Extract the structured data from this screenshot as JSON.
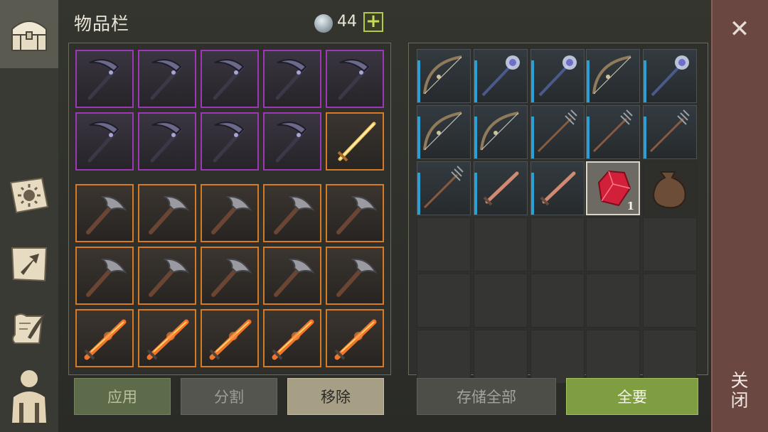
{
  "header": {
    "title": "物品栏",
    "currency_amount": "44",
    "add_label": "+"
  },
  "left_rail": {
    "items": [
      "chest-icon",
      "map-sun-icon",
      "map-arrow-icon",
      "scroll-quill-icon",
      "character-icon"
    ]
  },
  "inventory": {
    "rows_top": [
      [
        "purple-scythe",
        "purple-scythe",
        "purple-scythe",
        "purple-scythe",
        "purple-scythe"
      ],
      [
        "purple-scythe",
        "purple-scythe",
        "purple-scythe",
        "purple-scythe",
        "golden-sword"
      ]
    ],
    "rows_bottom": [
      [
        "iron-pickaxe",
        "iron-pickaxe",
        "iron-pickaxe",
        "iron-pickaxe",
        "iron-pickaxe"
      ],
      [
        "iron-pickaxe",
        "iron-pickaxe",
        "iron-pickaxe",
        "iron-pickaxe",
        "iron-pickaxe"
      ],
      [
        "flame-sword",
        "flame-sword",
        "flame-sword",
        "flame-sword",
        "flame-sword"
      ]
    ]
  },
  "storage": {
    "rows": [
      [
        "bow",
        "skull-staff",
        "skull-staff",
        "bow",
        "skull-staff"
      ],
      [
        "bow",
        "bow",
        "trident",
        "trident",
        "trident"
      ],
      [
        "trident",
        "dagger",
        "dagger",
        "red-gem",
        "leather-bag"
      ]
    ],
    "gem_quantity": "1"
  },
  "buttons": {
    "apply": "应用",
    "split": "分割",
    "remove": "移除",
    "store_all": "存储全部",
    "take_all": "全要"
  },
  "close": {
    "label": "关闭",
    "x_symbol": "✕"
  },
  "colors": {
    "rare_border": "#9c37b8",
    "epic_border": "#d67a23",
    "storage_accent": "#2aa0d4",
    "take_all_green": "#7f9e42"
  }
}
